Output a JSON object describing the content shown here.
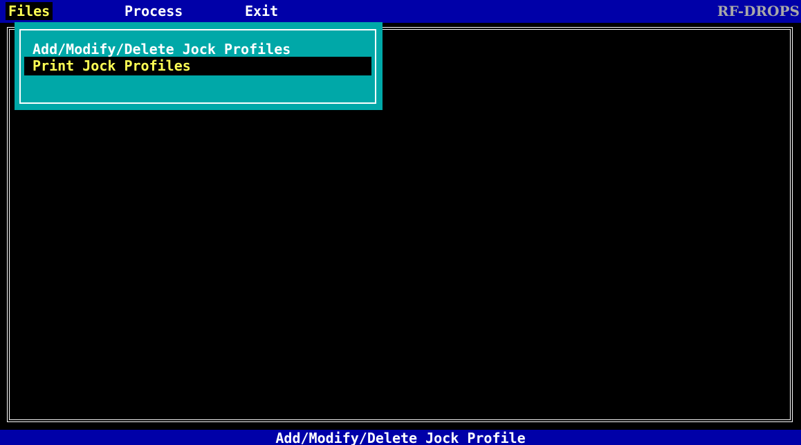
{
  "menubar": {
    "items": [
      {
        "label": "Files",
        "active": true
      },
      {
        "label": "Process",
        "active": false
      },
      {
        "label": "Exit",
        "active": false
      }
    ],
    "app_title": "RF-DROPS"
  },
  "dropdown": {
    "items": [
      {
        "label": "Add/Modify/Delete Jock Profiles",
        "selected": false
      },
      {
        "label": "Print Jock Profiles",
        "selected": true
      }
    ]
  },
  "statusbar": {
    "text": "Add/Modify/Delete Jock Profile"
  },
  "colors": {
    "menubar_bg": "#0000a8",
    "dropdown_bg": "#00a8a8",
    "highlight_text": "#ffff54",
    "text": "#ffffff",
    "background": "#000000"
  }
}
